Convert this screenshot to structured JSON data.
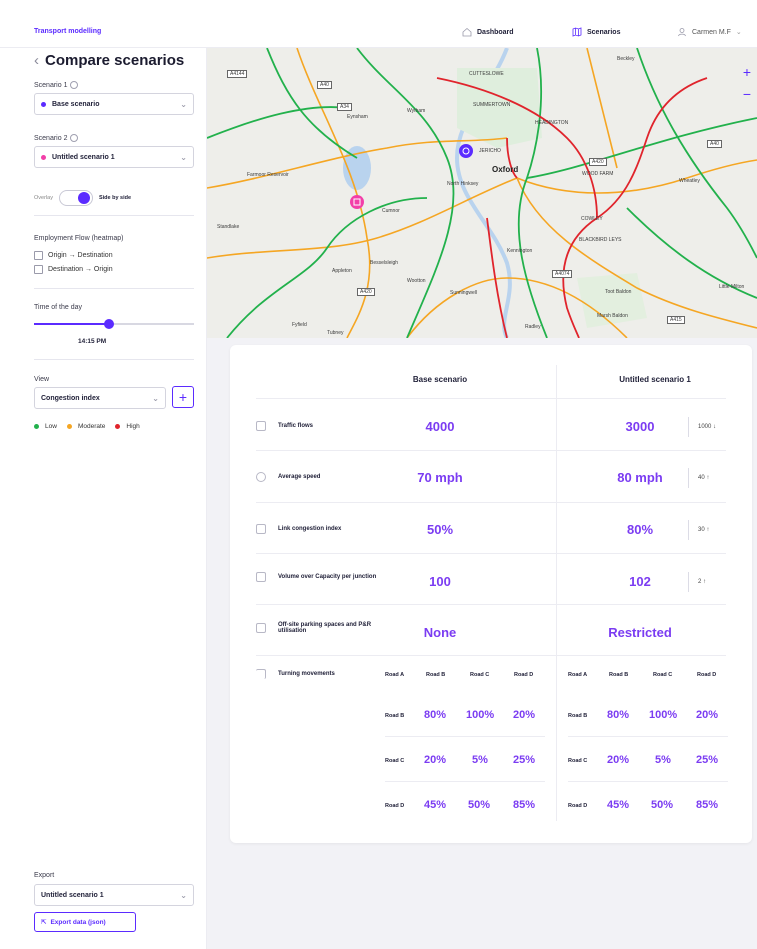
{
  "brand": "Transport modelling",
  "nav": {
    "dashboard": "Dashboard",
    "scenarios": "Scenarios",
    "user": "Carmen M.F"
  },
  "page_title": "Compare scenarios",
  "scenario1": {
    "label": "Scenario 1",
    "value": "Base scenario",
    "color": "#5b2bff"
  },
  "scenario2": {
    "label": "Scenario 2",
    "value": "Untitled scenario 1",
    "color": "#f23fa8"
  },
  "toggle": {
    "off_label": "Overlay",
    "on_label": "Side by side"
  },
  "employment": {
    "title": "Employment Flow (heatmap)",
    "options": [
      "Origin → Destination",
      "Destination → Origin"
    ]
  },
  "time": {
    "label": "Time of the day",
    "value": "14:15 PM",
    "fraction": 0.47
  },
  "view": {
    "label": "View",
    "value": "Congestion index"
  },
  "legend": [
    {
      "label": "Low",
      "color": "#22b14c"
    },
    {
      "label": "Moderate",
      "color": "#f5a623"
    },
    {
      "label": "High",
      "color": "#e0242c"
    }
  ],
  "export": {
    "label": "Export",
    "value": "Untitled scenario 1",
    "button": "Export data (json)"
  },
  "map": {
    "labels": {
      "cutteslowe": "CUTTESLOWE",
      "summertown": "SUMMERTOWN",
      "headington": "HEADINGTON",
      "oxford": "Oxford",
      "jericho": "JERICHO",
      "north_hinksey": "North Hinksey",
      "cumnor": "Cumnor",
      "appleton": "Appleton",
      "standlake": "Standlake",
      "wootton": "Wootton",
      "sunningwell": "Sunningwell",
      "kennington": "Kennington",
      "cowley": "COWLEY",
      "blackbird_leys": "BLACKBIRD LEYS",
      "toot_baldon": "Toot Baldon",
      "marsh_baldon": "Marsh Baldon",
      "radley": "Radley",
      "fyfield": "Fyfield",
      "tubney": "Tubney",
      "wheatley": "Wheatley",
      "little_milton": "Little Milton",
      "beckley": "Beckley",
      "wytham": "Wytham",
      "eynsham": "Eynsham",
      "besselsleigh": "Besselsleigh",
      "farmoor": "Farmoor Reservoir",
      "wood_farm": "WOOD FARM"
    },
    "road_tags": {
      "a4144": "A4144",
      "a40a": "A40",
      "a40b": "A40",
      "a420a": "A420",
      "a420b": "A420",
      "a34": "A34",
      "a4074": "A4074",
      "a415": "A415"
    }
  },
  "comparison": {
    "col1": "Base scenario",
    "col2": "Untitled scenario 1",
    "rows": [
      {
        "label": "Traffic flows",
        "base": "4000",
        "alt": "3000",
        "delta": "1000 ↓"
      },
      {
        "label": "Average speed",
        "base": "70 mph",
        "alt": "80 mph",
        "delta": "40 ↑"
      },
      {
        "label": "Link congestion index",
        "base": "50%",
        "alt": "80%",
        "delta": "30 ↑"
      },
      {
        "label": "Volume over Capacity per junction",
        "base": "100",
        "alt": "102",
        "delta": "2 ↑"
      },
      {
        "label": "Off-site parking spaces and P&R utilisation",
        "base": "None",
        "alt": "Restricted",
        "delta": ""
      }
    ],
    "turning": {
      "label": "Turning movements",
      "cols": [
        "Road A",
        "Road B",
        "Road C",
        "Road D"
      ],
      "rows": [
        {
          "road": "Road B",
          "base": [
            "80%",
            "100%",
            "20%"
          ],
          "alt": [
            "80%",
            "100%",
            "20%"
          ]
        },
        {
          "road": "Road C",
          "base": [
            "20%",
            "5%",
            "25%"
          ],
          "alt": [
            "20%",
            "5%",
            "25%"
          ]
        },
        {
          "road": "Road D",
          "base": [
            "45%",
            "50%",
            "85%"
          ],
          "alt": [
            "45%",
            "50%",
            "85%"
          ]
        }
      ]
    }
  }
}
